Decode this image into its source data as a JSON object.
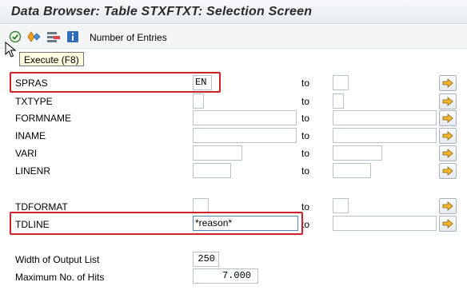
{
  "window": {
    "title": "Data Browser: Table STXFTXT: Selection Screen"
  },
  "toolbar": {
    "execute_icon": "execute-icon",
    "tooltip": "Execute   (F8)",
    "number_of_entries_label": "Number of Entries"
  },
  "selection": {
    "to_label": "to",
    "rows": [
      {
        "key": "spras",
        "label": "SPRAS",
        "low": "EN",
        "high": ""
      },
      {
        "key": "txtype",
        "label": "TXTYPE",
        "low": "",
        "high": ""
      },
      {
        "key": "formname",
        "label": "FORMNAME",
        "low": "",
        "high": ""
      },
      {
        "key": "iname",
        "label": "INAME",
        "low": "",
        "high": ""
      },
      {
        "key": "vari",
        "label": "VARI",
        "low": "",
        "high": ""
      },
      {
        "key": "linenr",
        "label": "LINENR",
        "low": "",
        "high": ""
      },
      {
        "key": "tdformat",
        "label": "TDFORMAT",
        "low": "",
        "high": ""
      },
      {
        "key": "tdline",
        "label": "TDLINE",
        "low": "*reason*",
        "high": ""
      }
    ]
  },
  "output": {
    "width_label": "Width of Output List",
    "width_value": "250",
    "maxhits_label": "Maximum No. of Hits",
    "maxhits_value": "7.000"
  },
  "colors": {
    "highlight": "#d0202a",
    "tooltip_bg": "#ffffe1"
  }
}
